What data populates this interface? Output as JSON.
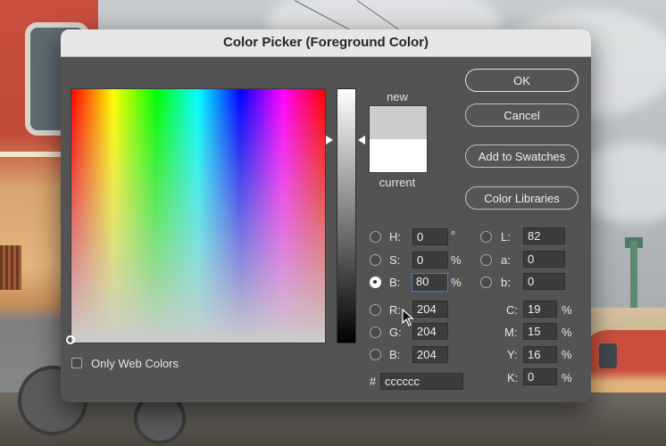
{
  "dialog": {
    "title": "Color Picker (Foreground Color)",
    "preview": {
      "new_label": "new",
      "current_label": "current",
      "new_color": "#cccccc",
      "current_color": "#ffffff"
    },
    "buttons": {
      "ok": "OK",
      "cancel": "Cancel",
      "add_swatches": "Add to Swatches",
      "color_libraries": "Color Libraries"
    },
    "hsb": {
      "h_label": "H:",
      "h_value": "0",
      "h_unit": "°",
      "s_label": "S:",
      "s_value": "0",
      "s_unit": "%",
      "b_label": "B:",
      "b_value": "80",
      "b_unit": "%"
    },
    "rgb": {
      "r_label": "R:",
      "r_value": "204",
      "g_label": "G:",
      "g_value": "204",
      "b_label": "B:",
      "b_value": "204"
    },
    "lab": {
      "l_label": "L:",
      "l_value": "82",
      "a_label": "a:",
      "a_value": "0",
      "b_label": "b:",
      "b_value": "0"
    },
    "cmyk": {
      "c_label": "C:",
      "c_value": "19",
      "c_unit": "%",
      "m_label": "M:",
      "m_value": "15",
      "m_unit": "%",
      "y_label": "Y:",
      "y_value": "16",
      "y_unit": "%",
      "k_label": "K:",
      "k_value": "0",
      "k_unit": "%"
    },
    "hex": {
      "label": "#",
      "value": "cccccc"
    },
    "only_web_colors": {
      "label": "Only Web Colors",
      "checked": false
    },
    "selected_component": "B"
  }
}
